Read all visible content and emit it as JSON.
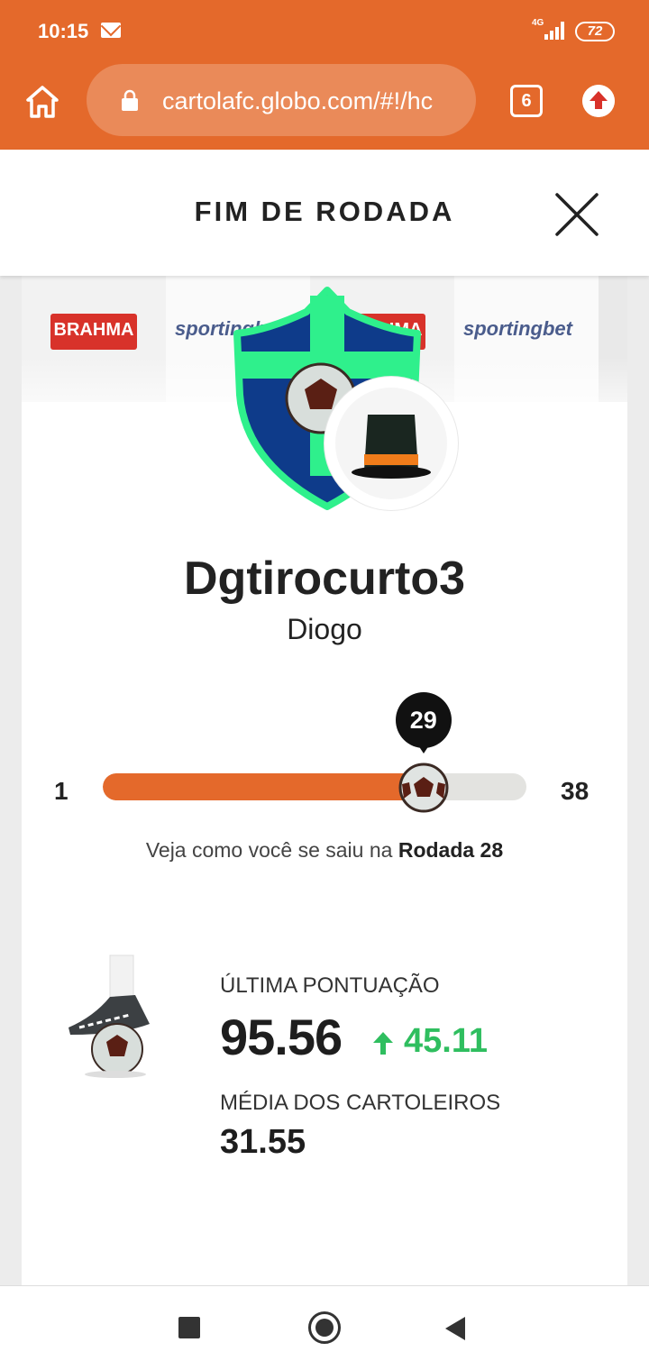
{
  "status_bar": {
    "time": "10:15",
    "network": "4G",
    "battery": "72"
  },
  "browser": {
    "url": "cartolafc.globo.com/#!/hc",
    "tab_count": "6"
  },
  "header": {
    "title": "FIM DE RODADA"
  },
  "sponsors": [
    "BRAHMA",
    "sportingbet",
    "BRAHMA",
    "sportingbet"
  ],
  "team": {
    "name": "Dgtirocurto3",
    "owner": "Diogo"
  },
  "round_slider": {
    "min": "1",
    "max": "38",
    "current": "29",
    "progress_fraction": 0.757
  },
  "round_caption": {
    "prefix": "Veja como você se saiu na",
    "round": "Rodada 28"
  },
  "score": {
    "last_label": "ÚLTIMA PONTUAÇÃO",
    "last_value": "95.56",
    "delta": "45.11",
    "avg_label": "MÉDIA DOS CARTOLEIROS",
    "avg_value": "31.55"
  },
  "colors": {
    "brand_orange": "#e4692b",
    "positive_green": "#2fbe5f",
    "crest_blue": "#0e3b8a",
    "crest_green": "#2ff08c"
  }
}
